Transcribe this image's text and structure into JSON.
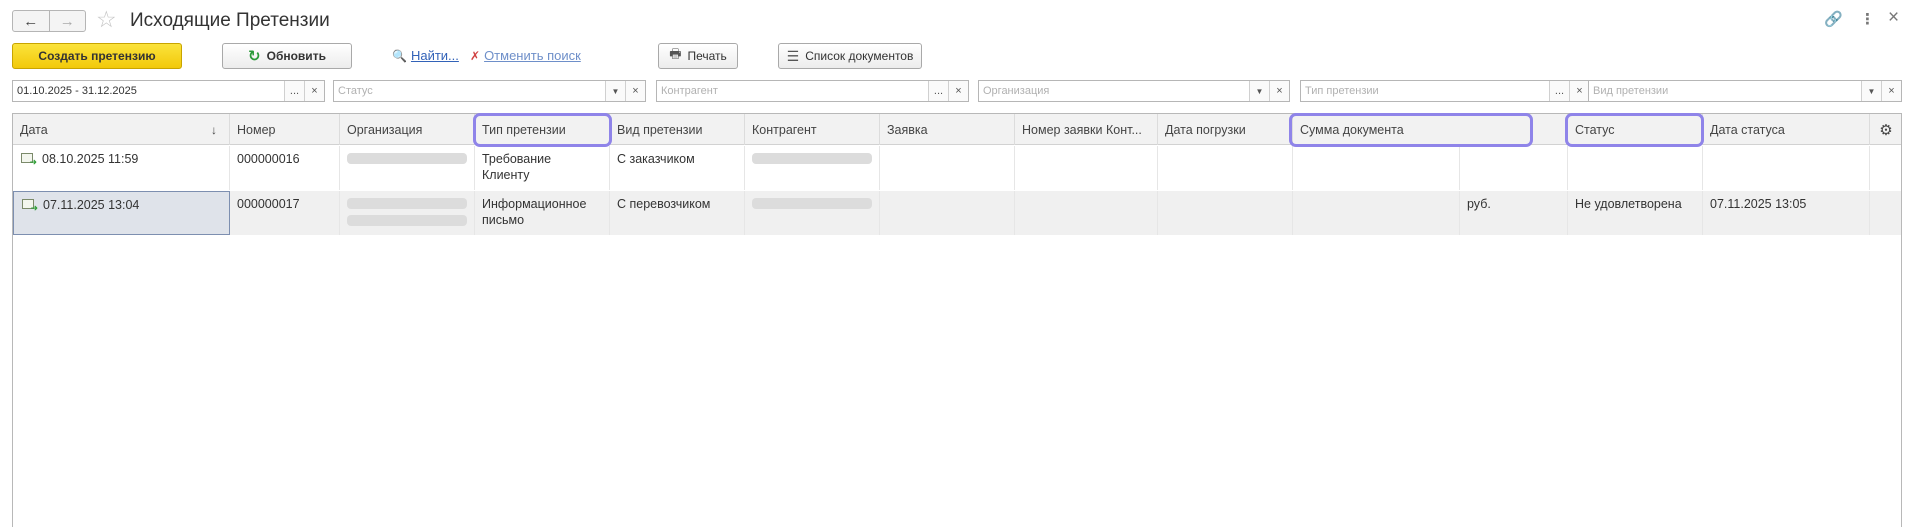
{
  "header": {
    "title": "Исходящие Претензии",
    "back_icon": "←",
    "forward_icon": "→",
    "star_icon": "☆",
    "link_icon": "🔗",
    "more_icon": "⋮",
    "close_icon": "×"
  },
  "toolbar": {
    "create_label": "Создать претензию",
    "refresh_label": "Обновить",
    "refresh_icon": "↻",
    "find_label": "Найти...",
    "find_icon": "🔍",
    "cancel_search_label": "Отменить поиск",
    "cancel_search_icon": "✗",
    "print_label": "Печать",
    "print_icon": "🖶",
    "doclist_label": "Список документов",
    "doclist_icon": "☰"
  },
  "filters": {
    "period": {
      "value": "01.10.2025 - 31.12.2025"
    },
    "status": {
      "placeholder": "Статус"
    },
    "counterparty": {
      "placeholder": "Контрагент"
    },
    "organization": {
      "placeholder": "Организация"
    },
    "claim_type": {
      "placeholder": "Тип претензии"
    },
    "claim_kind": {
      "placeholder": "Вид претензии"
    },
    "select_btn": "...",
    "clear_btn": "×",
    "dropdown_btn": "▼"
  },
  "table": {
    "sort_icon": "↓",
    "settings_icon": "⚙",
    "columns": [
      "Дата",
      "Номер",
      "Организация",
      "Тип претензии",
      "Вид претензии",
      "Контрагент",
      "Заявка",
      "Номер заявки Конт...",
      "Дата погрузки",
      "Сумма документа",
      "Статус",
      "Дата статуса"
    ],
    "rows": [
      {
        "date": "08.10.2025 11:59",
        "number": "000000016",
        "organization": "",
        "claim_type_line1": "Требование",
        "claim_type_line2": "Клиенту",
        "claim_kind": "С заказчиком",
        "counterparty": "",
        "request": "",
        "request_number": "",
        "load_date": "",
        "amount": "",
        "currency": "",
        "status": "",
        "status_date": ""
      },
      {
        "date": "07.11.2025 13:04",
        "number": "000000017",
        "organization": "",
        "claim_type_line1": "Информационное",
        "claim_type_line2": "письмо",
        "claim_kind": "С перевозчиком",
        "counterparty": "",
        "request": "",
        "request_number": "",
        "load_date": "",
        "amount": "",
        "currency": "руб.",
        "status": "Не удовлетворена",
        "status_date": "07.11.2025 13:05"
      }
    ]
  },
  "highlight_color": "#8f84e9",
  "create_button_color": "#f2c90a"
}
